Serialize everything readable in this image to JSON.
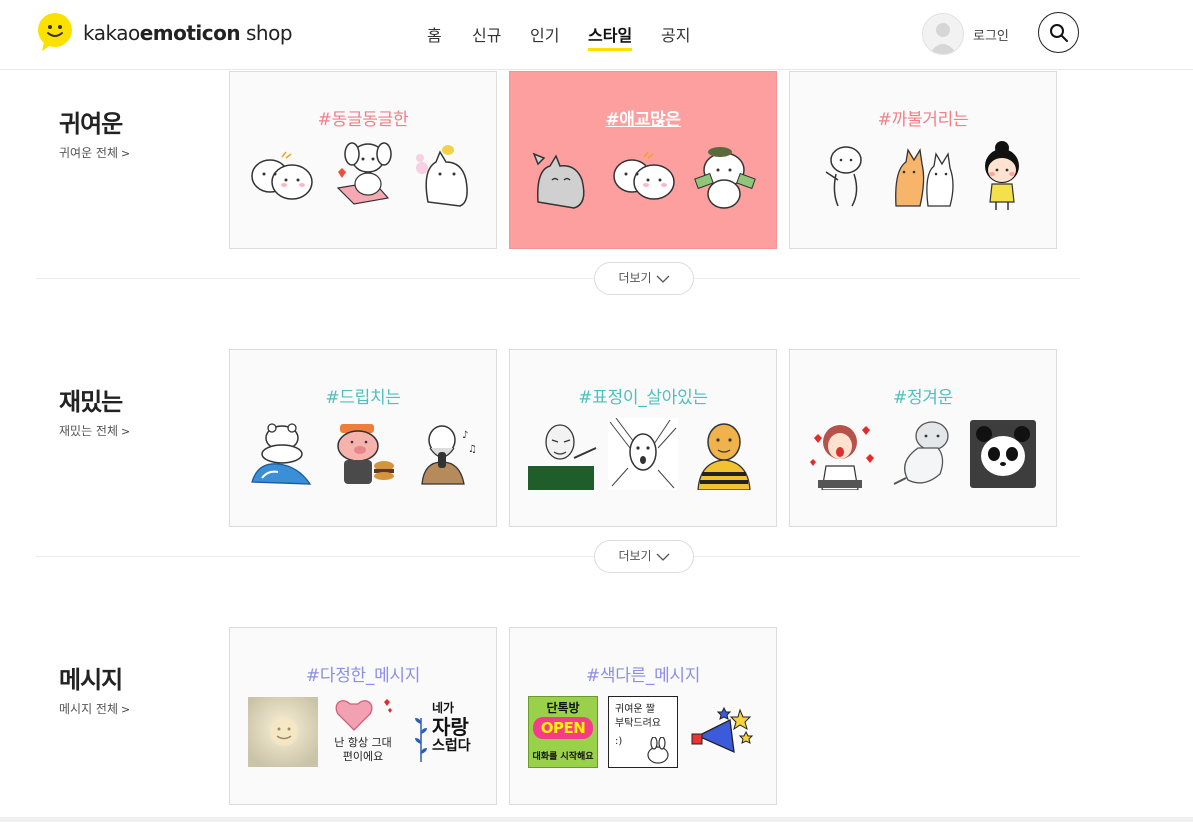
{
  "brand": {
    "name_light": "kakao",
    "name_bold": "emoticon",
    "name_suffix": " shop"
  },
  "nav": [
    {
      "label": "홈",
      "active": false
    },
    {
      "label": "신규",
      "active": false
    },
    {
      "label": "인기",
      "active": false
    },
    {
      "label": "스타일",
      "active": true
    },
    {
      "label": "공지",
      "active": false
    }
  ],
  "header": {
    "login_label": "로그인"
  },
  "colors": {
    "accent": "#fae100",
    "pink_tag": "#f07f88",
    "teal_tag": "#4fbfc0",
    "purple_tag": "#8c8fe6",
    "highlight_card": "#fd9f9f"
  },
  "sections": [
    {
      "title": "귀여운",
      "link": "귀여운 전체",
      "cards": [
        {
          "tag": "#동글동글한",
          "stickers": [
            "twin-dumpling-bunnies",
            "white-puppy-on-pink-cushion",
            "white-cat-with-bird"
          ]
        },
        {
          "tag": "#애교많은",
          "highlighted": true,
          "stickers": [
            "gray-cat-waving",
            "twin-dumpling-bunnies",
            "bear-holding-money"
          ]
        },
        {
          "tag": "#까불거리는",
          "stickers": [
            "white-blob-thinking",
            "orange-and-white-cats",
            "girl-with-bun-hair"
          ]
        }
      ],
      "more_label": "더보기"
    },
    {
      "title": "재밌는",
      "link": "재밌는 전체",
      "cards": [
        {
          "tag": "#드립치는",
          "stickers": [
            "bear-surfing-wave",
            "pig-eating-burger",
            "bearded-man-singing"
          ]
        },
        {
          "tag": "#표정이_살아있는",
          "stickers": [
            "man-pointing-sketch",
            "shocked-face-sketch",
            "bald-man-bee-shirt"
          ]
        },
        {
          "tag": "#정겨운",
          "stickers": [
            "granny-with-hearts",
            "seal-lying-down",
            "panda-face"
          ]
        }
      ],
      "more_label": "더보기"
    },
    {
      "title": "메시지",
      "link": "메시지 전체",
      "cards": [
        {
          "tag": "#다정한_메시지",
          "stickers": [
            "blurred-smiley-photo",
            "pink-heart-bunny-message",
            "calligraphy-leaf-message"
          ]
        },
        {
          "tag": "#색다른_메시지",
          "stickers": [
            "chat-open-sign",
            "cute-request-note",
            "megaphone-stars"
          ]
        }
      ]
    }
  ],
  "sticker_text": {
    "heart_msg": "난 항상 그대 편이에요",
    "calli_line1": "네가",
    "calli_line2": "자랑",
    "calli_line3": "스럽다",
    "open_top": "단톡방",
    "open_mid": "OPEN",
    "open_bottom": "대화를 시작해요",
    "note_line1": "귀여운 짤",
    "note_line2": "부탁드려요",
    "note_line3": ":)"
  }
}
